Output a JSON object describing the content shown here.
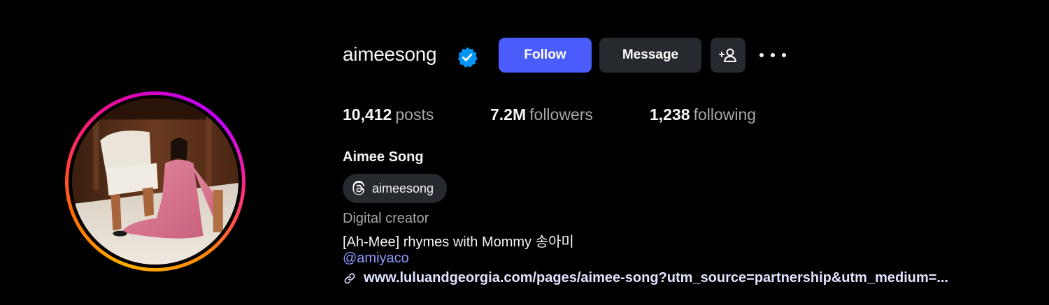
{
  "profile": {
    "username": "aimeesong",
    "verified": true,
    "full_name": "Aimee Song",
    "threads_handle": "aimeesong",
    "category": "Digital creator",
    "bio": "[Ah-Mee] rhymes with Mommy 송아미",
    "mention": "@amiyaco",
    "link": "www.luluandgeorgia.com/pages/aimee-song?utm_source=partnership&utm_medium=..."
  },
  "actions": {
    "follow_label": "Follow",
    "message_label": "Message",
    "add_user_icon": "add-user-icon",
    "more_icon": "more-options-icon"
  },
  "stats": {
    "posts_count": "10,412",
    "posts_label": "posts",
    "followers_count": "7.2M",
    "followers_label": "followers",
    "following_count": "1,238",
    "following_label": "following"
  },
  "colors": {
    "background": "#000000",
    "follow_button": "#4a5dfc",
    "secondary_button": "#262a2f",
    "verified_badge": "#0095f6",
    "mention_link": "#8a9bff",
    "muted_text": "#a8a8a8"
  }
}
